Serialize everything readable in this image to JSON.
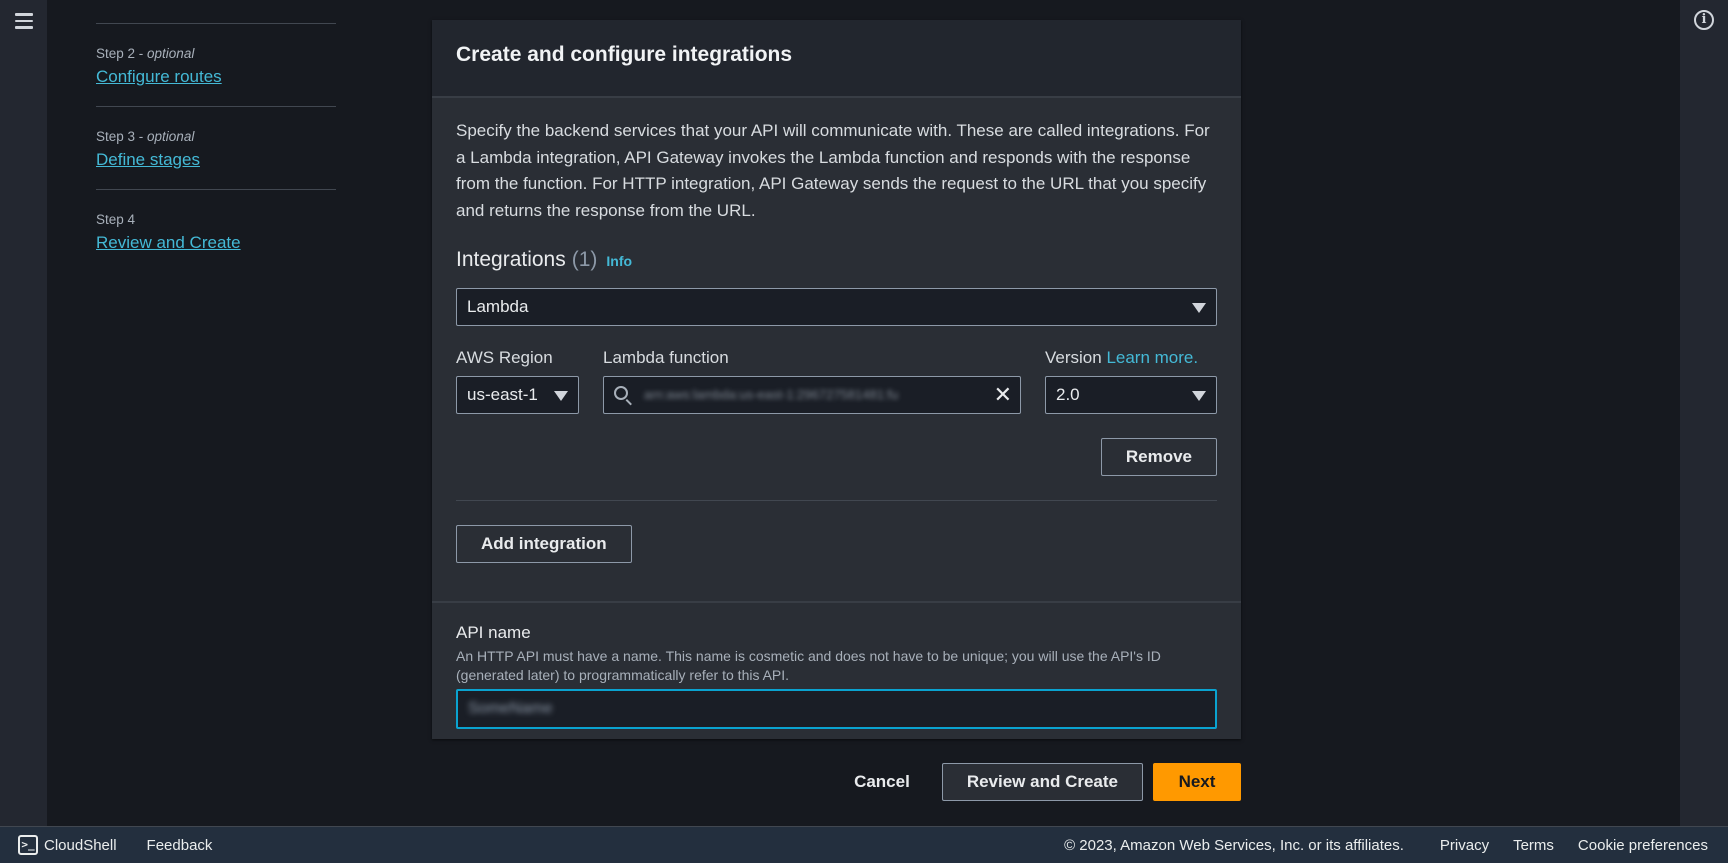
{
  "nav": {
    "menu_icon": "hamburger-menu-icon",
    "info_icon": "info-circle-icon"
  },
  "steps": [
    {
      "label": "Step 2",
      "suffix": "optional",
      "link": "Configure routes"
    },
    {
      "label": "Step 3",
      "suffix": "optional",
      "link": "Define stages"
    },
    {
      "label": "Step 4",
      "suffix": "",
      "link": "Review and Create"
    }
  ],
  "card": {
    "title": "Create and configure integrations",
    "description": "Specify the backend services that your API will communicate with. These are called integrations. For a Lambda integration, API Gateway invokes the Lambda function and responds with the response from the function. For HTTP integration, API Gateway sends the request to the URL that you specify and returns the response from the URL.",
    "integrations": {
      "title": "Integrations",
      "count": "(1)",
      "info": "Info",
      "type_value": "Lambda",
      "region_label": "AWS Region",
      "region_value": "us-east-1",
      "function_label": "Lambda function",
      "function_value": "arn:aws:lambda:us-east-1:296727581481:fu",
      "version_label": "Version",
      "version_link": "Learn more.",
      "version_value": "2.0",
      "remove_label": "Remove",
      "add_label": "Add integration"
    },
    "api_name": {
      "label": "API name",
      "description": "An HTTP API must have a name. This name is cosmetic and does not have to be unique; you will use the API's ID (generated later) to programmatically refer to this API.",
      "value": "SomeName"
    }
  },
  "actions": {
    "cancel": "Cancel",
    "review": "Review and Create",
    "next": "Next"
  },
  "footer": {
    "cloudshell": "CloudShell",
    "feedback": "Feedback",
    "copyright": "© 2023, Amazon Web Services, Inc. or its affiliates.",
    "privacy": "Privacy",
    "terms": "Terms",
    "cookies": "Cookie preferences"
  }
}
